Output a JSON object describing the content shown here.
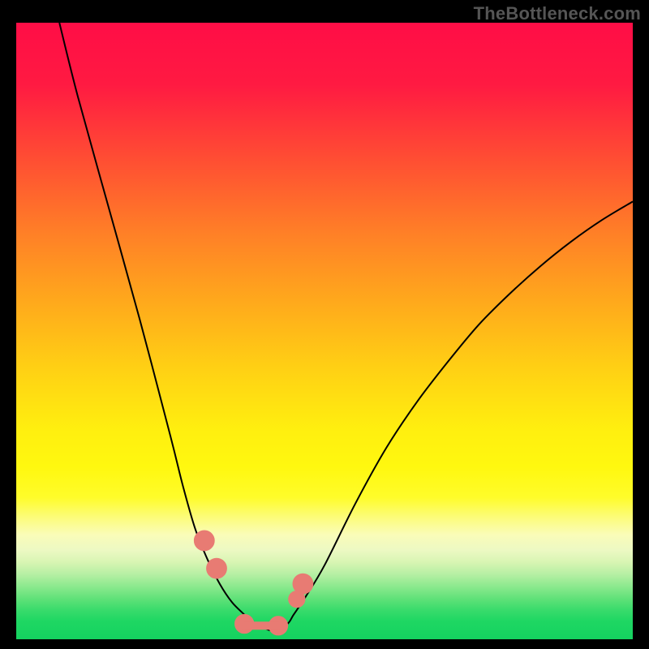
{
  "watermark": "TheBottleneck.com",
  "chart_data": {
    "type": "line",
    "title": "",
    "xlabel": "",
    "ylabel": "",
    "xlim": [
      0,
      100
    ],
    "ylim": [
      0,
      100
    ],
    "grid": false,
    "legend": false,
    "series": [
      {
        "name": "left-curve",
        "x": [
          7,
          10,
          15,
          20,
          25,
          27,
          29,
          31,
          33,
          35,
          37,
          38,
          40,
          41,
          42
        ],
        "y": [
          100,
          88,
          70,
          52,
          33,
          25,
          18,
          13,
          9,
          6,
          4,
          3,
          2,
          1.5,
          1.5
        ]
      },
      {
        "name": "right-curve",
        "x": [
          42,
          44,
          45,
          47,
          50,
          55,
          60,
          65,
          70,
          75,
          80,
          85,
          90,
          95,
          100
        ],
        "y": [
          1.5,
          2.5,
          4,
          7,
          12,
          22,
          31,
          38.5,
          45,
          51,
          56,
          60.5,
          64.5,
          68,
          71
        ]
      }
    ],
    "markers": [
      {
        "name": "left-marker-upper",
        "x": 30.5,
        "y": 16,
        "r": 1.6
      },
      {
        "name": "left-marker-lower",
        "x": 32.5,
        "y": 11.5,
        "r": 1.6
      },
      {
        "name": "right-marker-upper",
        "x": 46.5,
        "y": 9,
        "r": 1.6
      },
      {
        "name": "right-marker-lower",
        "x": 45.5,
        "y": 6.5,
        "r": 1.3
      },
      {
        "name": "bottom-lobe-left",
        "x": 37,
        "y": 2.5,
        "r": 1.5
      },
      {
        "name": "bottom-lobe-right",
        "x": 42.5,
        "y": 2.2,
        "r": 1.5
      }
    ],
    "bottom_connector": {
      "x1": 37,
      "x2": 42.5,
      "y": 2.2
    },
    "background_gradient_stops": [
      {
        "pos": 0,
        "color": "#ff0d46"
      },
      {
        "pos": 0.34,
        "color": "#ff7f27"
      },
      {
        "pos": 0.66,
        "color": "#ffef0f"
      },
      {
        "pos": 0.84,
        "color": "#fafcb8"
      },
      {
        "pos": 1.0,
        "color": "#14d25f"
      }
    ]
  }
}
